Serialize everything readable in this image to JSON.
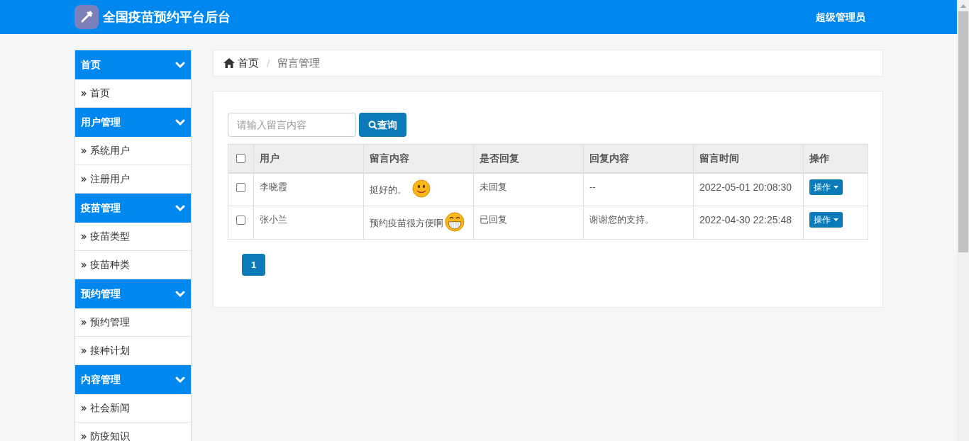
{
  "header": {
    "title": "全国疫苗预约平台后台",
    "user": "超级管理员"
  },
  "sidebar": {
    "groups": [
      {
        "title": "首页",
        "items": [
          {
            "label": "首页"
          }
        ]
      },
      {
        "title": "用户管理",
        "items": [
          {
            "label": "系统用户"
          },
          {
            "label": "注册用户"
          }
        ]
      },
      {
        "title": "疫苗管理",
        "items": [
          {
            "label": "疫苗类型"
          },
          {
            "label": "疫苗种类"
          }
        ]
      },
      {
        "title": "预约管理",
        "items": [
          {
            "label": "预约管理"
          },
          {
            "label": "接种计划"
          }
        ]
      },
      {
        "title": "内容管理",
        "items": [
          {
            "label": "社会新闻"
          },
          {
            "label": "防疫知识"
          }
        ]
      }
    ]
  },
  "breadcrumb": [
    "首页",
    "留言管理"
  ],
  "search": {
    "placeholder": "请输入留言内容",
    "button": "查询"
  },
  "table": {
    "select_all": {
      "checked": false
    },
    "columns": [
      "用户",
      "留言内容",
      "是否回复",
      "回复内容",
      "留言时间",
      "操作"
    ],
    "rows": [
      {
        "checked": false,
        "user": "李晓霞",
        "message": "挺好的。",
        "emoticon": {
          "kind": "smile"
        },
        "replied": "未回复",
        "reply": "--",
        "time": "2022-05-01 20:08:30",
        "action": "操作"
      },
      {
        "checked": false,
        "user": "张小兰",
        "message": "预约疫苗很方便啊",
        "emoticon": {
          "kind": "grin"
        },
        "replied": "已回复",
        "reply": "谢谢您的支持。",
        "time": "2022-04-30 22:25:48",
        "action": "操作"
      }
    ]
  },
  "pagination": [
    {
      "label": "1",
      "selected": true
    }
  ]
}
